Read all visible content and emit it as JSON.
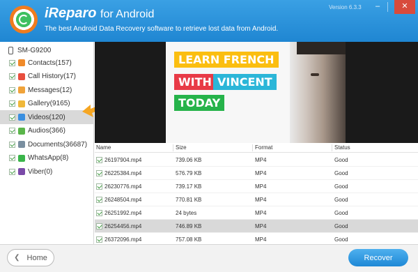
{
  "app": {
    "title": "iReparo",
    "title_for": "for Android",
    "subtitle": "The best Android Data Recovery software to retrieve lost data from Android.",
    "version": "Version 6.3.3"
  },
  "sidebar": {
    "device": "SM-G9200",
    "categories": [
      {
        "label": "Contacts(157)",
        "icon_color": "#f08a2a"
      },
      {
        "label": "Call History(17)",
        "icon_color": "#e84e3e"
      },
      {
        "label": "Messages(12)",
        "icon_color": "#f0a33a"
      },
      {
        "label": "Gallery(9165)",
        "icon_color": "#f0b83a"
      },
      {
        "label": "Videos(120)",
        "icon_color": "#3a8fe0"
      },
      {
        "label": "Audios(366)",
        "icon_color": "#5ab54a"
      },
      {
        "label": "Documents(36687)",
        "icon_color": "#7a8fa0"
      },
      {
        "label": "WhatsApp(8)",
        "icon_color": "#3ab54a"
      },
      {
        "label": "Viber(0)",
        "icon_color": "#7a4aa8"
      }
    ],
    "selected_index": 4
  },
  "preview": {
    "line1": "LEARN FRENCH",
    "line2a": "WITH",
    "line2b": "VINCENT",
    "line3": "TODAY"
  },
  "table": {
    "columns": [
      "Name",
      "Size",
      "Format",
      "Status"
    ],
    "rows": [
      {
        "name": "26197904.mp4",
        "size": "739.06 KB",
        "format": "MP4",
        "status": "Good"
      },
      {
        "name": "26225384.mp4",
        "size": "576.79 KB",
        "format": "MP4",
        "status": "Good"
      },
      {
        "name": "26230776.mp4",
        "size": "739.17 KB",
        "format": "MP4",
        "status": "Good"
      },
      {
        "name": "26248504.mp4",
        "size": "770.81 KB",
        "format": "MP4",
        "status": "Good"
      },
      {
        "name": "26251992.mp4",
        "size": "24 bytes",
        "format": "MP4",
        "status": "Good"
      },
      {
        "name": "26254456.mp4",
        "size": "746.89 KB",
        "format": "MP4",
        "status": "Good"
      },
      {
        "name": "26372096.mp4",
        "size": "757.08 KB",
        "format": "MP4",
        "status": "Good"
      }
    ],
    "selected_row": 5
  },
  "footer": {
    "home_label": "Home",
    "recover_label": "Recover"
  },
  "colors": {
    "header": "#2a93dc",
    "accent": "#1e88d6",
    "arrow": "#f5a623",
    "close": "#d84b3c"
  }
}
